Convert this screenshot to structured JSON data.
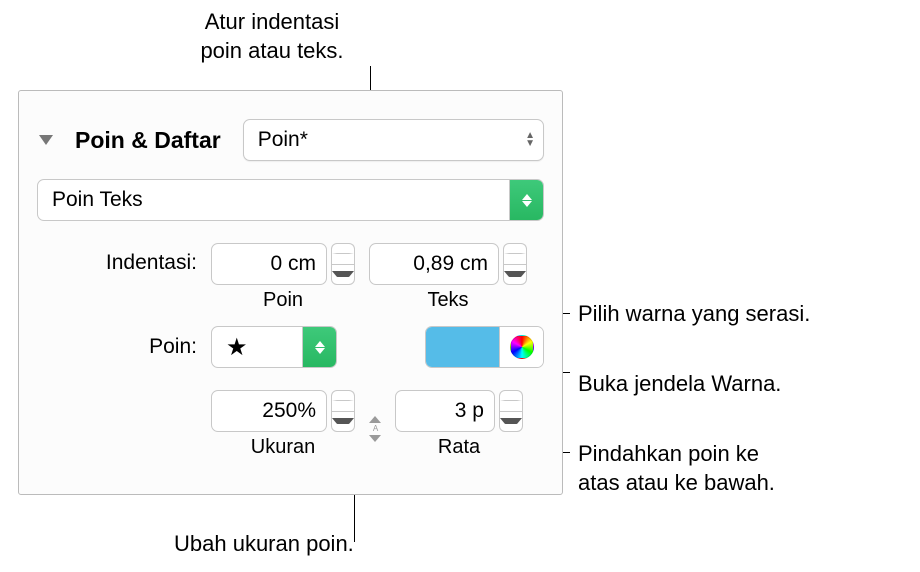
{
  "callouts": {
    "indent": "Atur indentasi\npoin atau teks.",
    "color_swatch": "Pilih warna yang serasi.",
    "color_wheel": "Buka jendela Warna.",
    "align": "Pindahkan poin ke\natas atau ke bawah.",
    "size": "Ubah ukuran poin."
  },
  "panel": {
    "section_title": "Poin & Daftar",
    "style_popup": "Poin*",
    "type_popup": "Poin Teks",
    "indent": {
      "label": "Indentasi:",
      "bullet": {
        "value": "0 cm",
        "sublabel": "Poin"
      },
      "text": {
        "value": "0,89 cm",
        "sublabel": "Teks"
      }
    },
    "bullet": {
      "label": "Poin:",
      "glyph": "★",
      "color": "#55bce8"
    },
    "size": {
      "value": "250%",
      "sublabel": "Ukuran"
    },
    "align": {
      "value": "3 p",
      "sublabel": "Rata"
    }
  }
}
